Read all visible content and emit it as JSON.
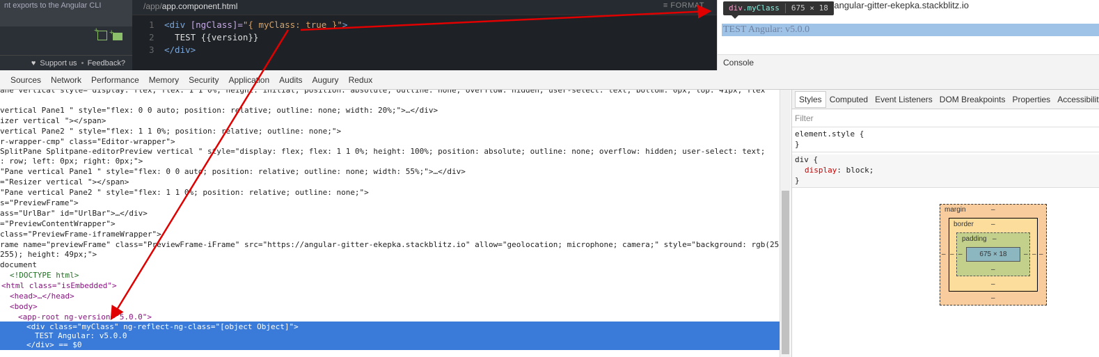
{
  "sidebar": {
    "top_text": "nt exports to the Angular CLI",
    "support_label": "Support us",
    "feedback_label": "Feedback?"
  },
  "editor": {
    "path_prefix": "/app/",
    "filename": "app.component.html",
    "format_label": "FORMAT",
    "lines": [
      {
        "num": "1",
        "open": "<div",
        "attr": "  [ngClass]=",
        "value": "\"{ myClass: true }\"",
        "close": ">"
      },
      {
        "num": "2",
        "text": "  TEST {{version}}"
      },
      {
        "num": "3",
        "close_tag": "</div>"
      }
    ]
  },
  "preview": {
    "url": "s://angular-gitter-ekepka.stackblitz.io",
    "tooltip_tag": "div",
    "tooltip_class": ".myClass",
    "tooltip_size": "675 × 18",
    "highlighted_text": "TEST Angular: v5.0.0",
    "console_label": "Console"
  },
  "devtools": {
    "tabs": [
      "Sources",
      "Network",
      "Performance",
      "Memory",
      "Security",
      "Application",
      "Audits",
      "Augury",
      "Redux"
    ]
  },
  "elements": {
    "rows": [
      "ane  vertical  style= display: flex; flex: 1 1 0%; height: initial; position: absolute; outline: none; overflow: hidden; user-select: text; bottom: 0px; top: 41px; flex",
      " vertical Pane1  \" style=\"flex: 0 0 auto; position: relative; outline: none; width: 20%;\">…</div>",
      "izer vertical \"></span>",
      " vertical Pane2  \" style=\"flex: 1 1 0%; position: relative; outline: none;\">",
      "r-wrapper-cmp\" class=\"Editor-wrapper\">",
      "SplitPane Splitpane-editorPreview   vertical \" style=\"display: flex; flex: 1 1 0%; height: 100%; position: absolute; outline: none; overflow: hidden; user-select: text;",
      ": row; left: 0px; right: 0px;\">",
      "\"Pane vertical Pane1  \" style=\"flex: 0 0 auto; position: relative; outline: none; width: 55%;\">…</div>",
      "=\"Resizer vertical \"></span>",
      "\"Pane vertical Pane2  \" style=\"flex: 1 1 0%; position: relative; outline: none;\">",
      "s=\"PreviewFrame\">",
      "ass=\"UrlBar\" id=\"UrlBar\">…</div>",
      "=\"PreviewContentWrapper\">",
      "class=\"PreviewFrame-iframeWrapper\">",
      "rame name=\"previewFrame\" class=\"PreviewFrame-iFrame\" src=\"https://angular-gitter-ekepka.stackblitz.io\" allow=\"geolocation; microphone; camera;\" style=\"background: rgb(255,",
      "255); height: 49px;\">",
      "document",
      "<!DOCTYPE html>",
      "<html class=\"isEmbedded\">",
      "<head>…</head>",
      "<body>",
      "<app-root ng-version=\"5.0.0\">",
      "<div class=\"myClass\" ng-reflect-ng-class=\"[object Object]\">",
      "TEST Angular: v5.0.0",
      "</div> == $0"
    ]
  },
  "styles_pane": {
    "tabs": [
      "Styles",
      "Computed",
      "Event Listeners",
      "DOM Breakpoints",
      "Properties",
      "Accessibility"
    ],
    "filter_placeholder": "Filter",
    "element_style": "element.style {",
    "close_brace": "}",
    "div_selector": "div {",
    "div_prop": "display",
    "div_value": "block;",
    "box_model": {
      "margin_label": "margin",
      "border_label": "border",
      "padding_label": "padding",
      "dash": "–",
      "content_size": "675 × 18"
    }
  },
  "colors": {
    "selection": "#3a7ad8",
    "arrow": "#e00000"
  }
}
